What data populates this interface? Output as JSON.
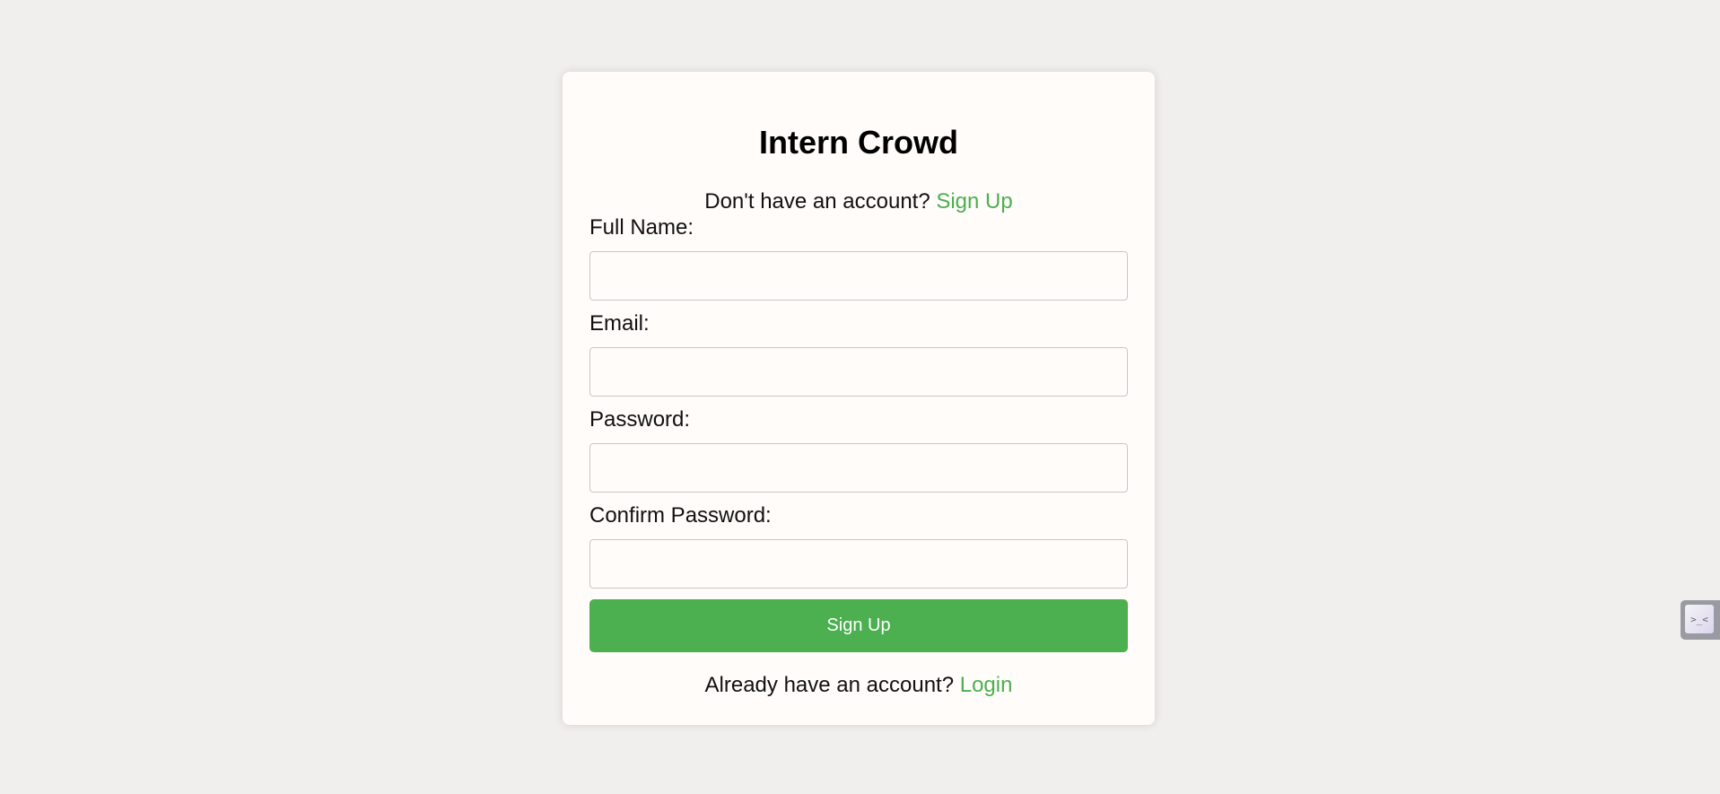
{
  "form": {
    "title": "Intern Crowd",
    "signup_prompt": {
      "text": "Don't have an account? ",
      "link_label": "Sign Up"
    },
    "fields": [
      {
        "label": "Full Name:",
        "value": ""
      },
      {
        "label": "Email:",
        "value": ""
      },
      {
        "label": "Password:",
        "value": ""
      },
      {
        "label": "Confirm Password:",
        "value": ""
      }
    ],
    "submit_label": "Sign Up",
    "login_prompt": {
      "text": "Already have an account? ",
      "link_label": "Login"
    }
  },
  "widget": {
    "icon": "terminal-face-icon",
    "glyph": ">_<"
  },
  "colors": {
    "accent": "#4caf50",
    "page_background": "#f1efed",
    "card_background": "#fffcfa"
  }
}
